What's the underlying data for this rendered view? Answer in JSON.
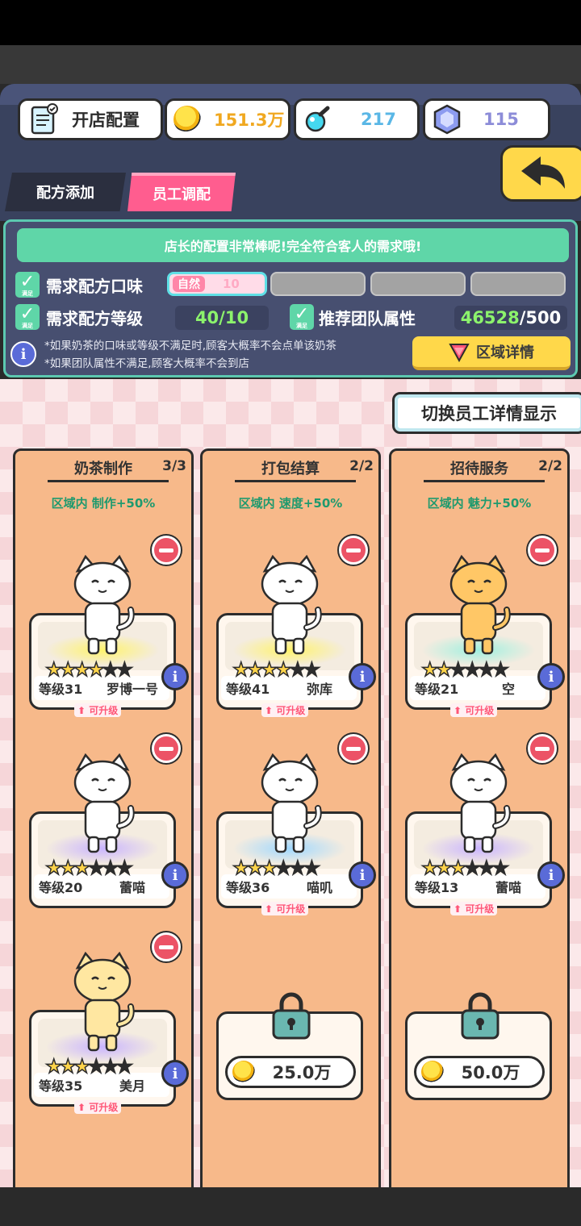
{
  "header": {
    "shop_config_label": "开店配置",
    "gold": "151.3万",
    "potion": "217",
    "gem": "115"
  },
  "tabs": [
    {
      "label": "配方添加",
      "active": false
    },
    {
      "label": "员工调配",
      "active": true
    }
  ],
  "config": {
    "banner": "店长的配置非常棒呢!完全符合客人的需求哦!",
    "check_small": "满足",
    "flavor_label": "需求配方口味",
    "flavor_tag": "自然",
    "flavor_value": "10",
    "level_label": "需求配方等级",
    "level_value": "40/10",
    "team_label": "推荐团队属性",
    "team_value": "46528",
    "team_target": "/500",
    "note1": "*如果奶茶的口味或等级不满足时,顾客大概率不会点单该奶茶",
    "note2": "*如果团队属性不满足,顾客大概率不会到店",
    "area_button": "区域详情"
  },
  "switch_button": "切换员工详情显示",
  "upgrade_label": "可升级",
  "columns": [
    {
      "title": "奶茶制作",
      "count": "3/3",
      "bonus": "区域内 制作+50%",
      "staff": [
        {
          "level": "等级31",
          "name": "罗博一号",
          "stars": 4,
          "upgrade": true,
          "color": "#ffffff",
          "glow": "#fff36b"
        },
        {
          "level": "等级20",
          "name": "蕾喵",
          "stars": 3,
          "upgrade": false,
          "color": "#ffffff",
          "glow": "#c9b4ff"
        },
        {
          "level": "等级35",
          "name": "美月",
          "stars": 3,
          "upgrade": true,
          "color": "#ffe7a1",
          "glow": "#c9b4ff"
        }
      ],
      "locked": []
    },
    {
      "title": "打包结算",
      "count": "2/2",
      "bonus": "区域内 速度+50%",
      "staff": [
        {
          "level": "等级41",
          "name": "弥库",
          "stars": 4,
          "upgrade": true,
          "color": "#ffffff",
          "glow": "#fff36b"
        },
        {
          "level": "等级36",
          "name": "喵叽",
          "stars": 3,
          "upgrade": true,
          "color": "#ffffff",
          "glow": "#9fd8ff"
        }
      ],
      "locked": [
        {
          "price": "25.0万"
        }
      ]
    },
    {
      "title": "招待服务",
      "count": "2/2",
      "bonus": "区域内 魅力+50%",
      "staff": [
        {
          "level": "等级21",
          "name": "空",
          "stars": 2,
          "upgrade": true,
          "color": "#ffc766",
          "glow": "#9ff0e0"
        },
        {
          "level": "等级13",
          "name": "蕾喵",
          "stars": 3,
          "upgrade": true,
          "color": "#ffffff",
          "glow": "#c9b4ff"
        }
      ],
      "locked": [
        {
          "price": "50.0万"
        }
      ]
    }
  ]
}
